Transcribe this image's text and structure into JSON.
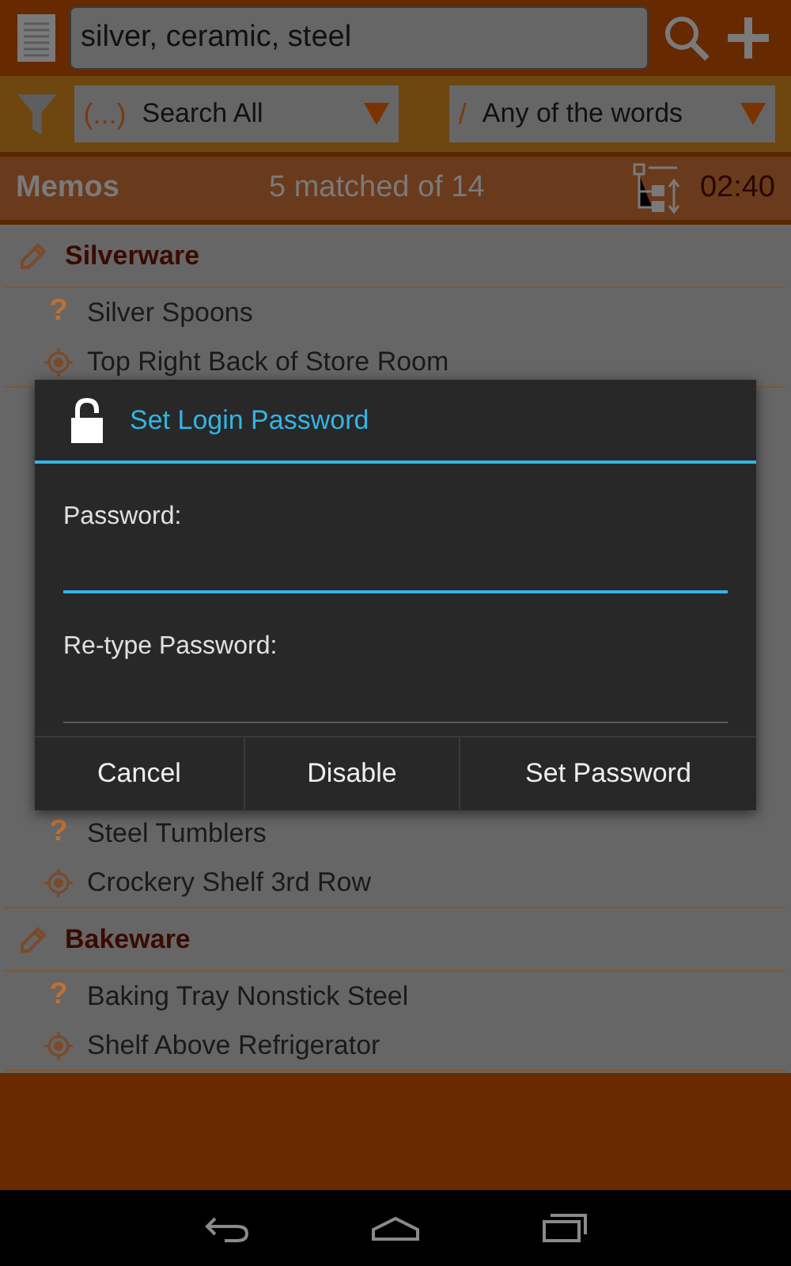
{
  "search": {
    "value": "silver, ceramic, steel"
  },
  "filters": [
    {
      "symbol": "(...)",
      "label": "Search All"
    },
    {
      "symbol": "/",
      "label": "Any of the words"
    }
  ],
  "header": {
    "title": "Memos",
    "count": "5 matched of 14",
    "time": "02:40"
  },
  "groups": [
    {
      "title": "Silverware",
      "items": [
        {
          "kind": "question",
          "marker": "?",
          "text": "Silver Spoons"
        },
        {
          "kind": "location",
          "text": "Top Right Back of Store Room"
        }
      ]
    },
    {
      "items": [
        {
          "kind": "question",
          "marker": "?",
          "text": "Steel Tumblers"
        },
        {
          "kind": "location",
          "text": "Crockery Shelf 3rd Row"
        }
      ]
    },
    {
      "title": "Bakeware",
      "items": [
        {
          "kind": "question",
          "marker": "?",
          "text": "Baking Tray Nonstick Steel"
        },
        {
          "kind": "location",
          "text": "Shelf Above Refrigerator"
        }
      ]
    }
  ],
  "dialog": {
    "title": "Set Login Password",
    "fields": [
      {
        "label": "Password:",
        "focused": true
      },
      {
        "label": "Re-type Password:",
        "focused": false
      }
    ],
    "buttons": [
      "Cancel",
      "Disable",
      "Set Password"
    ]
  }
}
